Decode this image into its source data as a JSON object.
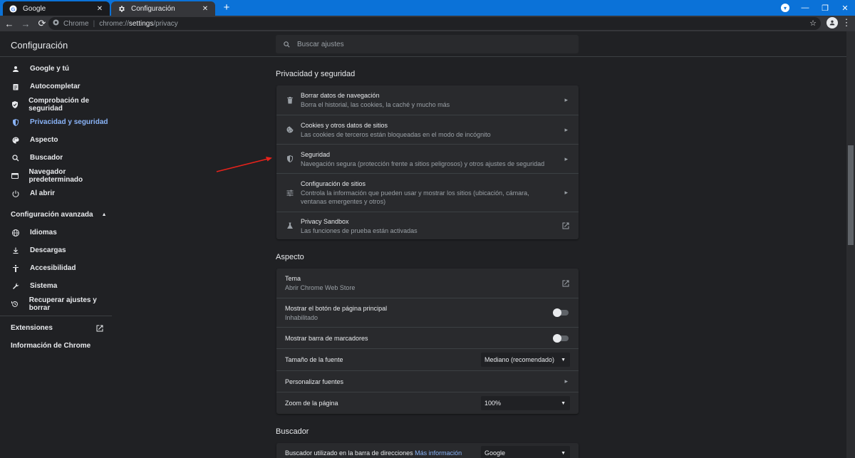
{
  "tabs": [
    {
      "title": "Google"
    },
    {
      "title": "Configuración"
    }
  ],
  "toolbar": {
    "site_label": "Chrome",
    "url_prefix": "chrome://",
    "url_host": "settings",
    "url_path": "/privacy"
  },
  "header": {
    "title": "Configuración",
    "search_placeholder": "Buscar ajustes"
  },
  "sidebar": {
    "items": [
      {
        "label": "Google y tú",
        "icon": "person-icon"
      },
      {
        "label": "Autocompletar",
        "icon": "clipboard-icon"
      },
      {
        "label": "Comprobación de seguridad",
        "icon": "shield-check-icon"
      },
      {
        "label": "Privacidad y seguridad",
        "icon": "shield-icon",
        "selected": true
      },
      {
        "label": "Aspecto",
        "icon": "palette-icon"
      },
      {
        "label": "Buscador",
        "icon": "search-icon"
      },
      {
        "label": "Navegador predeterminado",
        "icon": "browser-icon"
      },
      {
        "label": "Al abrir",
        "icon": "power-icon"
      }
    ],
    "advanced_label": "Configuración avanzada",
    "advanced_items": [
      {
        "label": "Idiomas",
        "icon": "globe-icon"
      },
      {
        "label": "Descargas",
        "icon": "download-icon"
      },
      {
        "label": "Accesibilidad",
        "icon": "accessibility-icon"
      },
      {
        "label": "Sistema",
        "icon": "wrench-icon"
      },
      {
        "label": "Recuperar ajustes y borrar",
        "icon": "restore-icon"
      }
    ],
    "extensions_label": "Extensiones",
    "about_label": "Información de Chrome"
  },
  "privacy": {
    "title": "Privacidad y seguridad",
    "rows": [
      {
        "title": "Borrar datos de navegación",
        "sub": "Borra el historial, las cookies, la caché y mucho más",
        "icon": "trash-icon"
      },
      {
        "title": "Cookies y otros datos de sitios",
        "sub": "Las cookies de terceros están bloqueadas en el modo de incógnito",
        "icon": "cookie-icon"
      },
      {
        "title": "Seguridad",
        "sub": "Navegación segura (protección frente a sitios peligrosos) y otros ajustes de seguridad",
        "icon": "shield-icon"
      },
      {
        "title": "Configuración de sitios",
        "sub": "Controla la información que pueden usar y mostrar los sitios (ubicación, cámara, ventanas emergentes y otros)",
        "icon": "sliders-icon"
      },
      {
        "title": "Privacy Sandbox",
        "sub": "Las funciones de prueba están activadas",
        "icon": "flask-icon"
      }
    ]
  },
  "appearance": {
    "title": "Aspecto",
    "theme_title": "Tema",
    "theme_sub": "Abrir Chrome Web Store",
    "home_title": "Mostrar el botón de página principal",
    "home_sub": "Inhabilitado",
    "bookmarks_title": "Mostrar barra de marcadores",
    "font_size_title": "Tamaño de la fuente",
    "font_size_value": "Mediano (recomendado)",
    "fonts_title": "Personalizar fuentes",
    "zoom_title": "Zoom de la página",
    "zoom_value": "100%"
  },
  "search_engine": {
    "title": "Buscador",
    "row_title": "Buscador utilizado en la barra de direcciones",
    "more_info": "Más información",
    "value": "Google"
  }
}
